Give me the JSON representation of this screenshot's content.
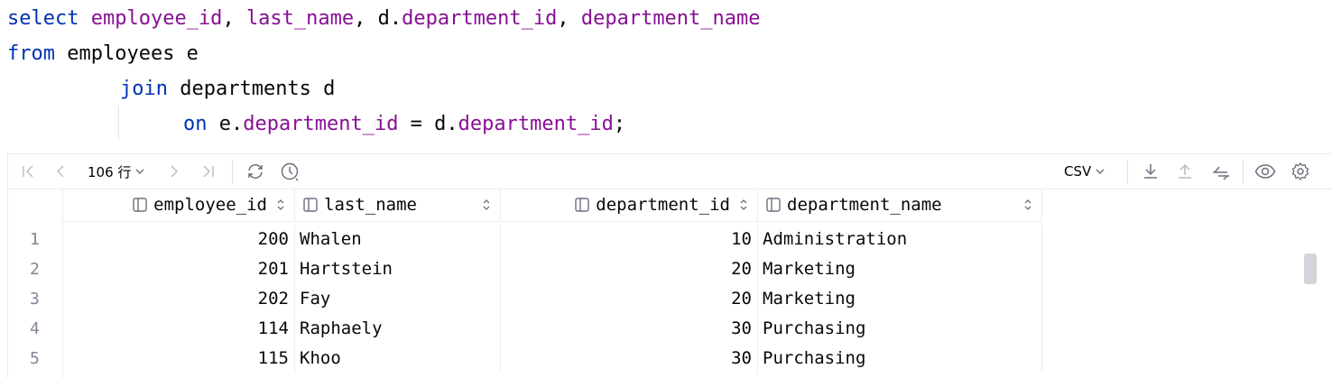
{
  "editor": {
    "line1": {
      "kw": "select",
      "c1": "employee_id",
      "sep1": ", ",
      "c2": "last_name",
      "sep2": ", ",
      "p3": "d.",
      "c3": "department_id",
      "sep3": ", ",
      "c4": "department_name"
    },
    "line2": {
      "kw": "from",
      "rest": " employees e"
    },
    "line3": {
      "kw": "join",
      "rest": " departments d"
    },
    "line4": {
      "kw": "on",
      "p1": " e.",
      "c1": "department_id",
      "p2": " = d.",
      "c2": "department_id",
      "p3": ";"
    }
  },
  "toolbar": {
    "row_count": "106 行",
    "export_format": "CSV",
    "icons": [
      "first-page-icon",
      "prev-page-icon",
      "next-page-icon",
      "last-page-icon",
      "refresh-icon",
      "history-icon",
      "download-icon",
      "upload-icon",
      "compare-icon",
      "eye-icon",
      "gear-icon"
    ]
  },
  "table": {
    "columns": [
      "employee_id",
      "last_name",
      "department_id",
      "department_name"
    ],
    "rows": [
      {
        "n": "1",
        "employee_id": "200",
        "last_name": "Whalen",
        "department_id": "10",
        "department_name": "Administration"
      },
      {
        "n": "2",
        "employee_id": "201",
        "last_name": "Hartstein",
        "department_id": "20",
        "department_name": "Marketing"
      },
      {
        "n": "3",
        "employee_id": "202",
        "last_name": "Fay",
        "department_id": "20",
        "department_name": "Marketing"
      },
      {
        "n": "4",
        "employee_id": "114",
        "last_name": "Raphaely",
        "department_id": "30",
        "department_name": "Purchasing"
      },
      {
        "n": "5",
        "employee_id": "115",
        "last_name": "Khoo",
        "department_id": "30",
        "department_name": "Purchasing"
      }
    ]
  },
  "colors": {
    "keyword": "#0033b3",
    "identifier": "#871094",
    "text": "#080808"
  }
}
